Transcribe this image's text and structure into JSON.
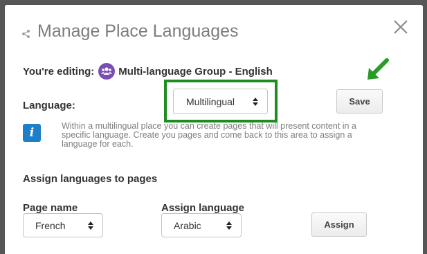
{
  "dialog": {
    "title": "Manage Place Languages"
  },
  "editing": {
    "label": "You're editing:",
    "group_name": "Multi-language Group - English"
  },
  "language": {
    "label": "Language:",
    "selected": "Multilingual",
    "highlight_color": "#1f8c1f"
  },
  "save_button": "Save",
  "info": {
    "icon_glyph": "i",
    "text": "Within a multilingual place you can create pages that will present content in a specific language. Create you pages and come back to this area to assign a language for each."
  },
  "assign_section": {
    "heading": "Assign languages to pages",
    "page_name_label": "Page name",
    "assign_language_label": "Assign language",
    "page_selected": "French",
    "language_selected": "Arabic",
    "assign_button": "Assign"
  },
  "colors": {
    "accent_info": "#1c7fc9",
    "group_icon": "#7a4db3",
    "arrow": "#2a9a2a"
  }
}
